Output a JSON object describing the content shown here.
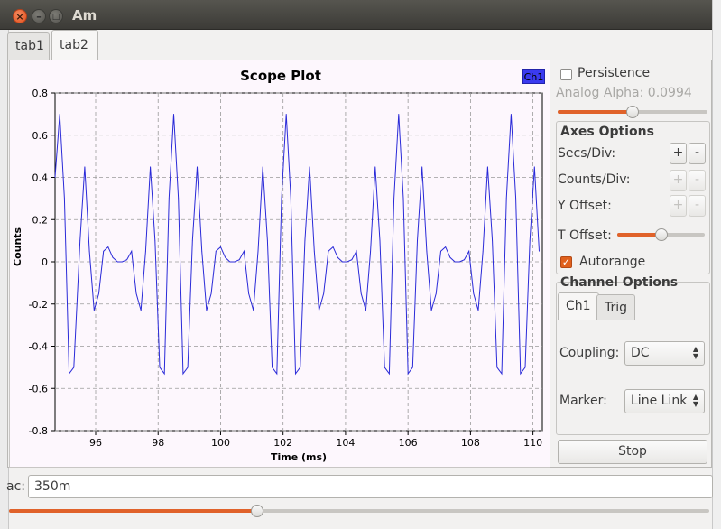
{
  "window": {
    "title": "Am"
  },
  "tabs": [
    {
      "label": "tab1"
    },
    {
      "label": "tab2"
    }
  ],
  "plot": {
    "title": "Scope Plot",
    "legend": "Ch1",
    "xlabel": "Time (ms)",
    "ylabel": "Counts"
  },
  "chart_data": {
    "type": "line",
    "title": "Scope Plot",
    "xlabel": "Time (ms)",
    "ylabel": "Counts",
    "xlim": [
      94.7,
      110.3
    ],
    "ylim": [
      -0.8,
      0.8
    ],
    "xticks": [
      "96",
      "98",
      "100",
      "102",
      "104",
      "106",
      "108",
      "110"
    ],
    "yticks": [
      "0.8",
      "0.6",
      "0.4",
      "0.2",
      "0",
      "-0.2",
      "-0.4",
      "-0.6",
      "-0.8"
    ],
    "grid": true,
    "legend_position": "top-right",
    "series": [
      {
        "name": "Ch1",
        "color": "#2a2ad8",
        "x": [
          94.7,
          94.85,
          95.0,
          95.15,
          95.3,
          95.5,
          95.65,
          95.8,
          95.95,
          96.1,
          96.25,
          96.4,
          96.55,
          96.7,
          96.85,
          97.0,
          97.15,
          97.3,
          97.45,
          97.6,
          97.75,
          97.9,
          98.05,
          98.2,
          98.35,
          98.5,
          98.65,
          98.8,
          98.95,
          99.1,
          99.25,
          99.4,
          99.55,
          99.7,
          99.85,
          100.0,
          100.15,
          100.3,
          100.45,
          100.6,
          100.75,
          100.9,
          101.05,
          101.2,
          101.35,
          101.5,
          101.65,
          101.8,
          101.95,
          102.1,
          102.25,
          102.4,
          102.55,
          102.7,
          102.85,
          103.0,
          103.15,
          103.3,
          103.45,
          103.6,
          103.75,
          103.9,
          104.05,
          104.2,
          104.35,
          104.5,
          104.65,
          104.8,
          104.95,
          105.1,
          105.25,
          105.4,
          105.55,
          105.7,
          105.85,
          106.0,
          106.15,
          106.3,
          106.45,
          106.6,
          106.75,
          106.9,
          107.05,
          107.2,
          107.35,
          107.5,
          107.65,
          107.8,
          107.95,
          108.1,
          108.25,
          108.4,
          108.55,
          108.7,
          108.85,
          109.0,
          109.15,
          109.3,
          109.45,
          109.6,
          109.75,
          109.9,
          110.05,
          110.2
        ],
        "y": [
          0.4,
          0.7,
          0.3,
          -0.53,
          -0.5,
          0.1,
          0.45,
          0.05,
          -0.23,
          -0.15,
          0.05,
          0.07,
          0.02,
          0.0,
          0.0,
          0.01,
          0.05,
          -0.15,
          -0.23,
          0.05,
          0.45,
          0.1,
          -0.5,
          -0.53,
          0.3,
          0.7,
          0.3,
          -0.53,
          -0.5,
          0.1,
          0.45,
          0.05,
          -0.23,
          -0.15,
          0.05,
          0.07,
          0.02,
          0.0,
          0.0,
          0.01,
          0.05,
          -0.15,
          -0.23,
          0.05,
          0.45,
          0.1,
          -0.5,
          -0.53,
          0.3,
          0.7,
          0.3,
          -0.53,
          -0.5,
          0.1,
          0.45,
          0.05,
          -0.23,
          -0.15,
          0.05,
          0.07,
          0.02,
          0.0,
          0.0,
          0.01,
          0.05,
          -0.15,
          -0.23,
          0.05,
          0.45,
          0.1,
          -0.5,
          -0.53,
          0.3,
          0.7,
          0.3,
          -0.53,
          -0.5,
          0.1,
          0.45,
          0.05,
          -0.23,
          -0.15,
          0.05,
          0.07,
          0.02,
          0.0,
          0.0,
          0.01,
          0.05,
          -0.15,
          -0.23,
          0.05,
          0.45,
          0.1,
          -0.5,
          -0.53,
          0.3,
          0.7,
          0.3,
          -0.53,
          -0.5,
          0.1,
          0.45,
          0.05
        ]
      }
    ]
  },
  "side": {
    "persistence_label": "Persistence",
    "persistence_checked": false,
    "analog_alpha_label": "Analog Alpha: 0.0994",
    "analog_alpha_level": 0.5,
    "axes_options_label": "Axes Options",
    "secs_div_label": "Secs/Div:",
    "counts_div_label": "Counts/Div:",
    "y_offset_label": "Y Offset:",
    "t_offset_label": "T Offset:",
    "t_offset_level": 0.5,
    "plus": "+",
    "minus": "-",
    "autorange_label": "Autorange",
    "autorange_checked": true,
    "autorange_check_glyph": "✓",
    "channel_options_label": "Channel Options",
    "channel_tabs": [
      {
        "label": "Ch1"
      },
      {
        "label": "Trig"
      }
    ],
    "coupling_label": "Coupling:",
    "coupling_value": "DC",
    "marker_label": "Marker:",
    "marker_value": "Line Link",
    "stop_label": "Stop"
  },
  "bottom": {
    "label": "ac:",
    "input_value": "350m",
    "slider_level": 0.355
  },
  "colors": {
    "accent": "#e0622a",
    "trace": "#2a2ad8",
    "plot_bg": "#fdf7fd"
  }
}
